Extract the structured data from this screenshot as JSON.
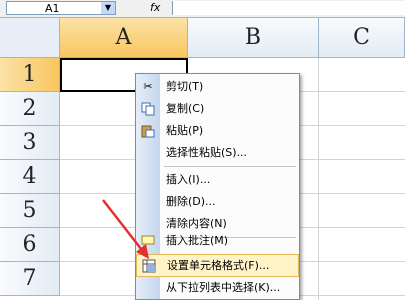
{
  "formula_bar": {
    "name_box": "A1",
    "fx_label": "fx"
  },
  "columns": [
    "A",
    "B",
    "C"
  ],
  "rows": [
    "1",
    "2",
    "3",
    "4",
    "5",
    "6",
    "7"
  ],
  "context_menu": {
    "items": [
      {
        "label": "剪切(T)",
        "icon": "scissors-icon"
      },
      {
        "label": "复制(C)",
        "icon": "copy-icon"
      },
      {
        "label": "粘贴(P)",
        "icon": "paste-icon"
      },
      {
        "label": "选择性粘贴(S)...",
        "icon": ""
      },
      {
        "label": "插入(I)...",
        "icon": ""
      },
      {
        "label": "删除(D)...",
        "icon": ""
      },
      {
        "label": "清除内容(N)",
        "icon": ""
      },
      {
        "label": "插入批注(M)",
        "icon": "comment-icon"
      },
      {
        "label": "设置单元格格式(F)...",
        "icon": "format-cells-icon"
      },
      {
        "label": "从下拉列表中选择(K)...",
        "icon": ""
      }
    ]
  },
  "colors": {
    "selected_header": "#f9c660",
    "menu_highlight": "#fff4c8",
    "arrow": "#e53030"
  }
}
